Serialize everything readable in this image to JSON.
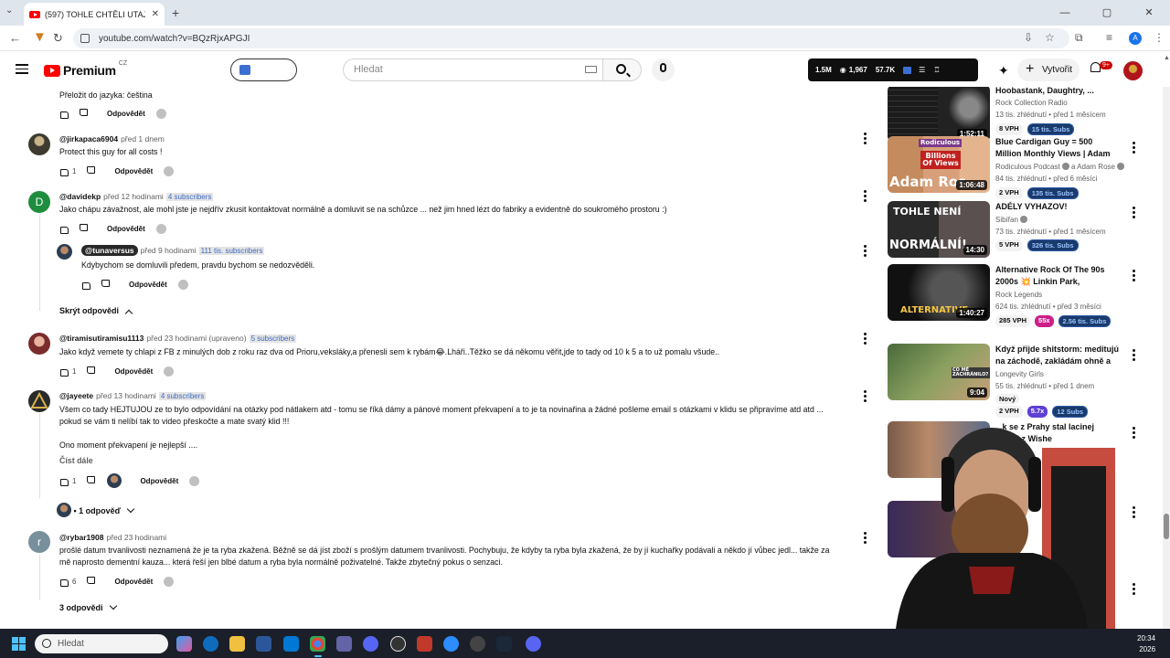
{
  "browser": {
    "tab_title": "(597) TOHLE CHTĚLI UTAJIT! M...",
    "tab_close": "✕",
    "new_tab": "+",
    "url": "youtube.com/watch?v=BQzRjxAPGJI",
    "profile_initial": "A",
    "window_controls": [
      "—",
      "▢",
      "✕"
    ]
  },
  "header": {
    "logo_text": "Premium",
    "country": "CZ",
    "search_placeholder": "Hledat",
    "stats": {
      "views": "1.5M",
      "watching": "1,967",
      "likes": "57.7K"
    },
    "create_label": "Vytvořit",
    "notifications": "9+"
  },
  "comments": [
    {
      "translate": "Přeložit do jazyka: čeština",
      "reply": "Odpovědět"
    },
    {
      "handle": "@jirkapaca6904",
      "time": "před 1 dnem",
      "text": "Protect this guy for all costs !",
      "likes": "1",
      "reply": "Odpovědět"
    },
    {
      "handle": "@davidekp",
      "time": "před 12 hodinami",
      "subs": "4 subscribers",
      "avatar_letter": "D",
      "avatar_color": "#1e8e3e",
      "text": "Jako chápu závažnost, ale mohl jste je nejdřív zkusit kontaktovat normálně a domluvit se na schůzce ... než jim hned lézt do fabriky a evidentně do soukromého prostoru :)",
      "reply": "Odpovědět"
    },
    {
      "handle": "@tunaversus",
      "time": "před 9 hodinami",
      "subs": "111 tis. subscribers",
      "text": "Kdybychom se domluvili předem, pravdu bychom se nedozvěděli.",
      "reply": "Odpovědět"
    },
    {
      "handle": "@tiramisutiramisu1113",
      "time": "před 23 hodinami (upraveno)",
      "subs": "5 subscribers",
      "text": "Jako když vemete ty chlapi z FB z minulých dob z roku raz dva od Prioru,veksláky,a přenesli sem k rybám😂.Lháři..Těžko se dá někomu věřit,jde to tady od 10 k 5   a to už pomalu všude..",
      "likes": "1",
      "reply": "Odpovědět"
    },
    {
      "handle": "@jayeete",
      "time": "před 13 hodinami",
      "subs": "4 subscribers",
      "text_line1": "Všem co tady HEJTUJOU ze to bylo odpovídání na otázky pod nátlakem atd - tomu se říká dámy a pánové moment překvapení a to je ta novinařina a žádné pošleme email s otázkami v klidu se připravíme atd atd ...",
      "text_line2": "pokud se vám ti nelíbí tak to video přeskočte a mate svatý klid !!!",
      "text_line3": "Ono moment překvapení je nejlepší ....",
      "read_more": "Číst dále",
      "likes": "1",
      "reply": "Odpovědět"
    },
    {
      "handle": "@rybar1908",
      "time": "před 23 hodinami",
      "avatar_letter": "r",
      "avatar_color": "#78909c",
      "text_line1": "prošlé datum trvanlivosti neznamená že je ta ryba zkažená. Běžně se dá jíst zboží s prošlým datumem trvanlivosti. Pochybuju, že kdyby ta ryba byla zkažená, že by jí kuchařky podávali a někdo jí vůbec jedl... takže za",
      "text_line2": "mě naprosto dementní kauza... která řeší jen blbé datum a ryba byla normálně poživatelné. Takže zbytečný pokus o senzaci.",
      "likes": "6",
      "reply": "Odpovědět"
    }
  ],
  "toggles": {
    "hide_replies": "Skrýt odpovědi",
    "one_reply": "• 1 odpověď",
    "three_replies": "3 odpovědi"
  },
  "sidebar": [
    {
      "title": "Hoobastank, Daughtry, ...",
      "channel": "Rock Collection Radio",
      "meta": "13 tis. zhlédnutí • před 1 měsícem",
      "duration": "1:52:11",
      "vph": "8 VPH",
      "subs": "15 tis. Subs"
    },
    {
      "title": "Blue Cardigan Guy = 500 Million Monthly Views | Adam Rose - ...",
      "channel": "Rodiculous Podcast",
      "channel2": "a Adam Rose",
      "meta": "84 tis. zhlédnutí • před 6 měsíci",
      "duration": "1:06:48",
      "vph": "2 VPH",
      "subs": "135 tis. Subs",
      "thumb_top": "Rodiculous",
      "thumb_mid": "Billions Of Views",
      "thumb_bottom": "Adam Ros"
    },
    {
      "title": "ADÉLY VYHAZOV!",
      "channel": "Sibiřan",
      "meta": "73 tis. zhlédnutí • před 1 měsícem",
      "duration": "14:30",
      "vph": "5 VPH",
      "subs": "326 tis. Subs",
      "thumb_top": "TOHLE NENÍ",
      "thumb_bottom": "NORMÁLNÍ!"
    },
    {
      "title": "Alternative Rock Of The 90s 2000s 💥 Linkin Park, Coldpla...",
      "channel": "Rock Legends",
      "meta": "624 tis. zhlédnutí • před 3 měsíci",
      "duration": "1:40:27",
      "vph": "285 VPH",
      "mult": "55x",
      "subs": "2.56 tis. Subs",
      "thumb_bottom": "ALTERNATIVE"
    },
    {
      "title": "Když přijde shitstorm: meditujú na záchodě, zakládám ohně a ...",
      "channel": "Longevity Girls",
      "meta": "55 tis. zhlédnutí • před 1 dnem",
      "novy": "Nový",
      "duration": "9:04",
      "vph": "2 VPH",
      "mult": "5.7x",
      "subs": "12 Subs",
      "thumb_top": "CO MĚ ZACHRÁNILO?"
    },
    {
      "title": "...k se z Prahy stal lacinej ...land z Wishe",
      "channel": "..."
    }
  ],
  "taskbar": {
    "search": "Hledat",
    "time": "20:34",
    "date": "2026"
  },
  "colors": {
    "brand_red": "#ff0000",
    "link_blue": "#3e6ac1",
    "chrome_bg": "#dfe5ec",
    "taskbar": "#1b1f2a"
  }
}
